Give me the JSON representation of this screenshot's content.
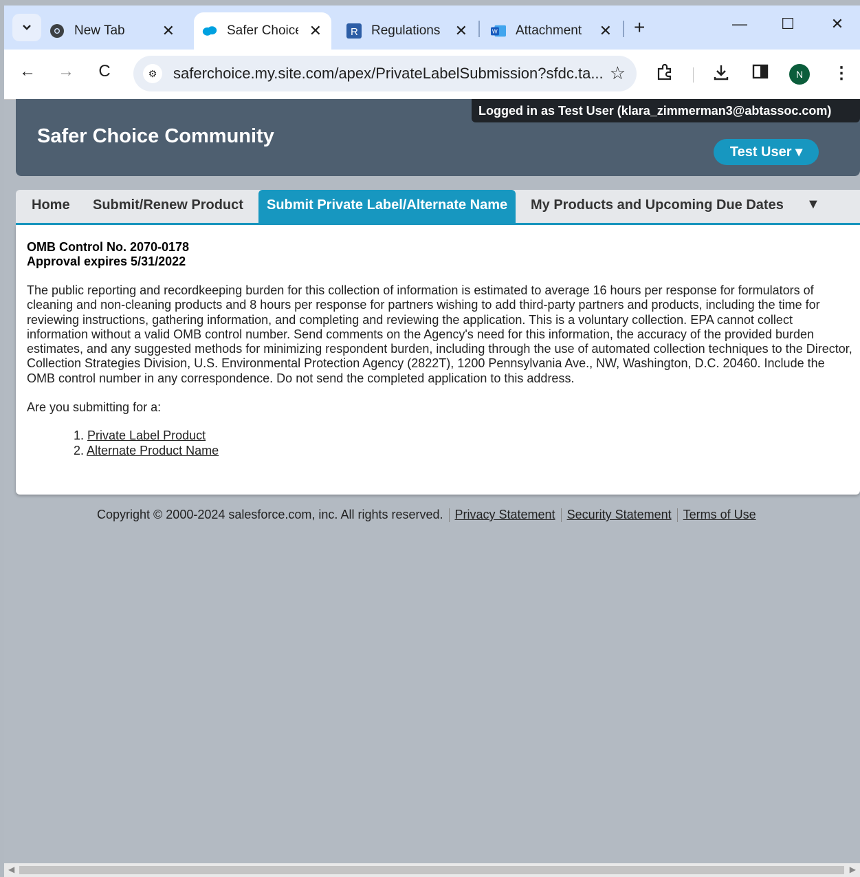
{
  "browser": {
    "tabs": [
      {
        "title": "New Tab",
        "icon": "chrome-icon"
      },
      {
        "title": "Safer Choice",
        "icon": "salesforce-cloud-icon",
        "active": true
      },
      {
        "title": "Regulations",
        "icon": "regulations-r-icon"
      },
      {
        "title": "Attachment",
        "icon": "word-icon"
      }
    ],
    "url": "saferchoice.my.site.com/apex/PrivateLabelSubmission?sfdc.ta...",
    "profile_initial": "N",
    "accent_color": "#d3e3fd"
  },
  "header": {
    "title": "Safer Choice Community",
    "logged_in": "Logged in as Test User (klara_zimmerman3@abtassoc.com)",
    "user_button": "Test User ▾",
    "color": "#4e5f70",
    "button_color": "#1797c0"
  },
  "nav": {
    "tabs": [
      "Home",
      "Submit/Renew Product",
      "Submit Private Label/Alternate Name",
      "My Products and Upcoming Due Dates"
    ],
    "active": "Submit Private Label/Alternate Name",
    "more": "▼"
  },
  "content": {
    "omb_control": "OMB Control No. 2070-0178",
    "approval": "Approval expires 5/31/2022",
    "paragraph": "The public reporting and recordkeeping burden for this collection of information is estimated to average 16 hours per response for formulators of cleaning and non-cleaning products and 8 hours per response for partners wishing to add third-party partners and products, including the time for reviewing instructions, gathering information, and completing and reviewing the application. This is a voluntary collection. EPA cannot collect information without a valid OMB control number. Send comments on the Agency's need for this information, the accuracy of the provided burden estimates, and any suggested methods for minimizing respondent burden, including through the use of automated collection techniques to the Director, Collection Strategies Division, U.S. Environmental Protection Agency (2822T), 1200 Pennsylvania Ave., NW, Washington, D.C. 20460. Include the OMB control number in any correspondence. Do not send the completed application to this address.",
    "question": "Are you submitting for a:",
    "options": [
      "Private Label Product",
      "Alternate Product Name"
    ]
  },
  "footer": {
    "copyright": "Copyright © 2000-2024 salesforce.com, inc. All rights reserved.",
    "links": [
      "Privacy Statement",
      "Security Statement",
      "Terms of Use"
    ]
  }
}
